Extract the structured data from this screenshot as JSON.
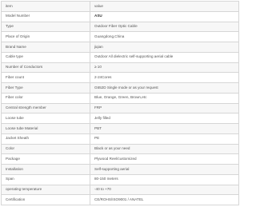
{
  "table": {
    "header": {
      "key": "item",
      "value": "value"
    },
    "rows": [
      {
        "key": "Model Number",
        "value": "ASU"
      },
      {
        "key": "Type",
        "value": "Outdoor Fiber Optic Cable"
      },
      {
        "key": "Place of Origin",
        "value": "Guangdong,China"
      },
      {
        "key": "Brand Name",
        "value": "jiqian"
      },
      {
        "key": "Cable type",
        "value": "Outdoor All dielectric self-supporting aerial cable"
      },
      {
        "key": "Number of Conductors",
        "value": "≥ 10"
      },
      {
        "key": "Fiber count",
        "value": "2-24Cores"
      },
      {
        "key": "Fiber Type",
        "value": "G652D Single mode or as your request"
      },
      {
        "key": "Fiber color",
        "value": "Blue, Orange, Green, Brown,etc"
      },
      {
        "key": "Central strength member",
        "value": "FRP"
      },
      {
        "key": "Loose tube",
        "value": "Jelly filled"
      },
      {
        "key": "Loose tube Material",
        "value": "PBT"
      },
      {
        "key": "Jacket Sheath",
        "value": "PE"
      },
      {
        "key": "Color",
        "value": "Black or as your need"
      },
      {
        "key": "Package",
        "value": "Plywood Reel/customized"
      },
      {
        "key": "Installation",
        "value": "Self-supporting aerial"
      },
      {
        "key": "Span",
        "value": "80-150 meters"
      },
      {
        "key": "operating temperature",
        "value": "-40 to +70"
      },
      {
        "key": "Certification",
        "value": "CE/ROHS/ISO9001 / ANATEL"
      }
    ]
  }
}
